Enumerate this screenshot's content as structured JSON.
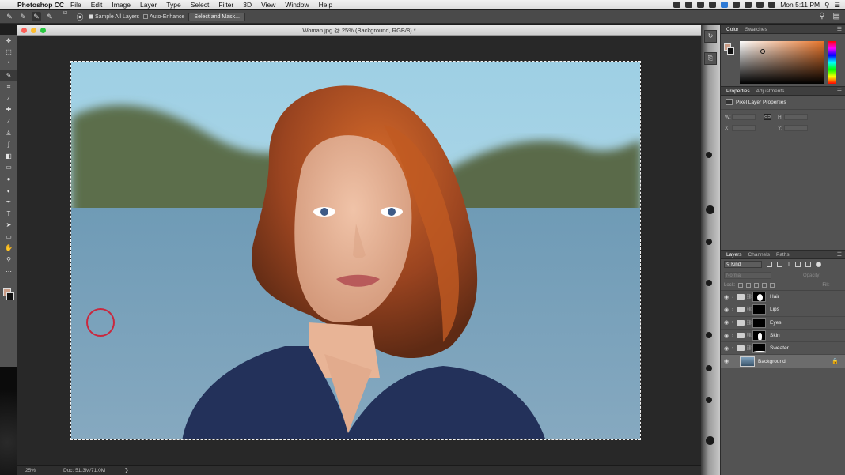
{
  "menubar": {
    "app_name": "Photoshop CC",
    "items": [
      "File",
      "Edit",
      "Image",
      "Layer",
      "Type",
      "Select",
      "Filter",
      "3D",
      "View",
      "Window",
      "Help"
    ],
    "clock": "Mon 5:11 PM"
  },
  "options_bar": {
    "brush_size": "53",
    "sample_all_layers": "Sample All Layers",
    "auto_enhance": "Auto-Enhance",
    "select_mask_button": "Select and Mask..."
  },
  "document": {
    "title": "Woman.jpg @ 25% (Background, RGB/8) *",
    "zoom": "25%",
    "doc_size": "Doc: 51.3M/71.0M",
    "status_arrow": "❯"
  },
  "color_panel": {
    "tabs": [
      "Color",
      "Swatches"
    ],
    "foreground": "#c99c86",
    "background": "#111111"
  },
  "properties_panel": {
    "tabs": [
      "Properties",
      "Adjustments"
    ],
    "title": "Pixel Layer Properties",
    "w_label": "W:",
    "h_label": "H:",
    "x_label": "X:",
    "y_label": "Y:"
  },
  "layers_panel": {
    "tabs": [
      "Layers",
      "Channels",
      "Paths"
    ],
    "kind_label": "Kind",
    "blend_mode": "Normal",
    "opacity_label": "Opacity:",
    "lock_label": "Lock:",
    "fill_label": "Fill:",
    "layers": [
      {
        "name": "Hair",
        "type": "group"
      },
      {
        "name": "Lips",
        "type": "group"
      },
      {
        "name": "Eyes",
        "type": "group"
      },
      {
        "name": "Skin",
        "type": "group"
      },
      {
        "name": "Sweater",
        "type": "group"
      },
      {
        "name": "Background",
        "type": "pixel",
        "selected": true,
        "locked": true
      }
    ]
  }
}
